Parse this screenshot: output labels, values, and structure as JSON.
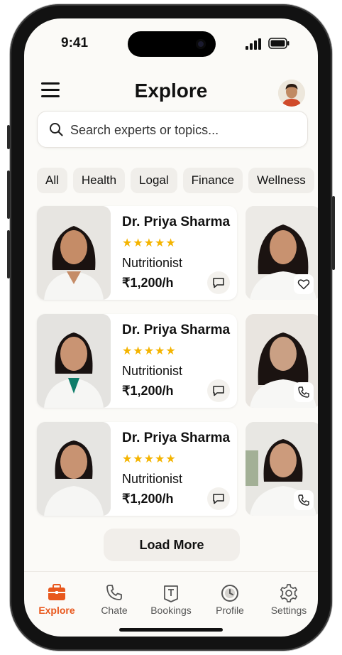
{
  "status": {
    "time": "9:41"
  },
  "header": {
    "title": "Explore"
  },
  "search": {
    "placeholder": "Search experts or topics..."
  },
  "categories": [
    "All",
    "Health",
    "Logal",
    "Finance",
    "Wellness"
  ],
  "experts": [
    {
      "name": "Dr. Priya Sharma",
      "rating": 4.5,
      "stars": "★★★★★",
      "role": "Nutritionist",
      "price": "₹1,200/h",
      "side_action": "heart-icon"
    },
    {
      "name": "Dr. Priya Sharma",
      "rating": 4.5,
      "stars": "★★★★★",
      "role": "Nutritionist",
      "price": "₹1,200/h",
      "side_action": "phone-icon"
    },
    {
      "name": "Dr. Priya Sharma",
      "rating": 4.5,
      "stars": "★★★★★",
      "role": "Nutritionist",
      "price": "₹1,200/h",
      "side_action": "phone-icon"
    }
  ],
  "load_more": "Load More",
  "nav": [
    {
      "label": "Explore",
      "icon": "briefcase-icon",
      "active": true
    },
    {
      "label": "Chate",
      "icon": "phone-icon",
      "active": false
    },
    {
      "label": "Bookings",
      "icon": "calendar-icon",
      "active": false
    },
    {
      "label": "Profile",
      "icon": "clock-icon",
      "active": false
    },
    {
      "label": "Settings",
      "icon": "gear-icon",
      "active": false
    }
  ],
  "colors": {
    "accent": "#e8571c",
    "star": "#f4b400",
    "background": "#fbfaf7"
  }
}
